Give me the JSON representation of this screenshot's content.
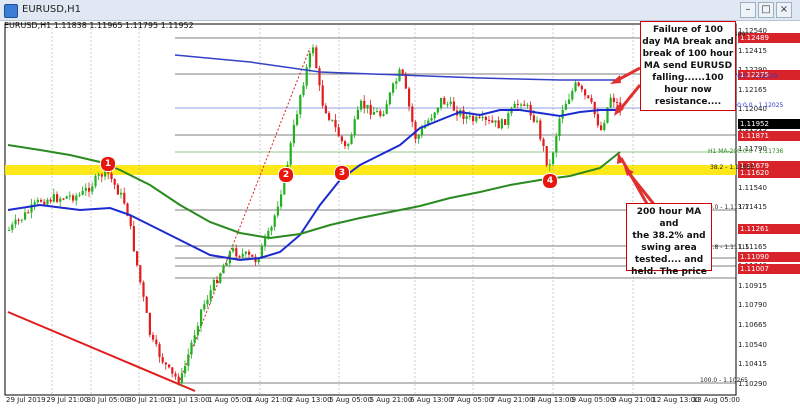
{
  "window": {
    "title": "EURUSD,H1"
  },
  "ohlc_header": "EURUSD,H1 1.11838 1.11965 1.11795 1.11952",
  "price_labels": [
    {
      "text": "1.12489",
      "color": "#d8232a"
    },
    {
      "text": "1.12275",
      "color": "#d8232a"
    },
    {
      "text": "1.11952",
      "color": "#000000"
    },
    {
      "text": "1.11871",
      "color": "#d8232a"
    },
    {
      "text": "1.11679",
      "color": "#d8232a"
    },
    {
      "text": "1.11620",
      "color": "#d8232a"
    },
    {
      "text": "1.11261",
      "color": "#d8232a"
    },
    {
      "text": "1.11090",
      "color": "#d8232a"
    },
    {
      "text": "1.11007",
      "color": "#d8232a"
    }
  ],
  "price_axis": [
    "1.12540",
    "1.12415",
    "1.12290",
    "1.12165",
    "1.12040",
    "1.11915",
    "1.11790",
    "1.11665",
    "1.11540",
    "1.11415",
    "1.11290",
    "1.11165",
    "1.11040",
    "1.10915",
    "1.10790",
    "1.10665",
    "1.10540",
    "1.10415",
    "1.10290"
  ],
  "time_axis": [
    "29 Jul 2019",
    "29 Jul 21:00",
    "30 Jul 05:00",
    "30 Jul 21:00",
    "31 Jul 13:00",
    "1 Aug 05:00",
    "1 Aug 21:00",
    "2 Aug 13:00",
    "5 Aug 05:00",
    "5 Aug 21:00",
    "6 Aug 13:00",
    "7 Aug 05:00",
    "7 Aug 21:00",
    "8 Aug 13:00",
    "9 Aug 05:00",
    "9 Aug 21:00",
    "12 Aug 13:00",
    "13 Aug 05:00"
  ],
  "levels": {
    "fib0": "0.0 - 1.12489",
    "ma100day": "100.0/0.0 - 1.12219",
    "h1ma100": "H1 MA-100:0.0 - 1.12025",
    "h1ma200": "H1 MA-200:0.0 - 1.11736",
    "fib382": "38.2 - 1.11659",
    "fib50": "50.0 - 1.11377",
    "fib618": "61.8 - 1.11115",
    "fib100": "100.0 - 1.10265"
  },
  "annotations": {
    "top": [
      "Failure of 100",
      "day MA break and",
      "break of 100 hour",
      "MA send EURUSD",
      "falling......100",
      "hour now",
      "resistance...."
    ],
    "bottom": [
      "200 hour MA and",
      "the 38.2% and",
      "swing area",
      "tested.... and",
      "held.  The price"
    ]
  },
  "markers": [
    "1",
    "2",
    "3",
    "4"
  ],
  "colors": {
    "ma100": "#1c2bd0",
    "ma200": "#2a8a1f",
    "day_ma": "#3340c8",
    "zone": "#ffe600",
    "trend": "#e11c1c",
    "bull": "#20b020",
    "bear": "#e11c1c"
  }
}
